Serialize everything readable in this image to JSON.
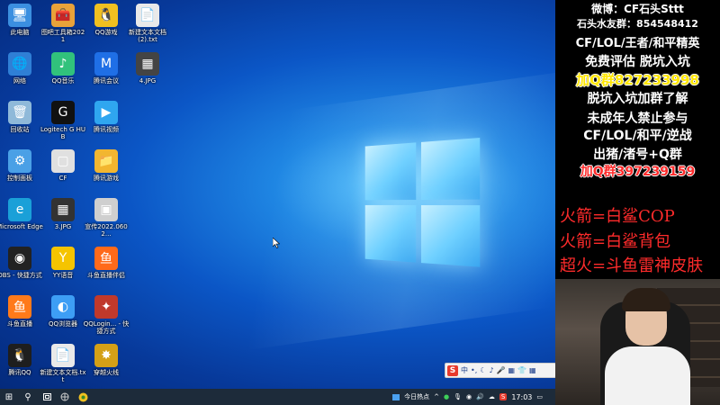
{
  "desktop_icons": [
    {
      "label": "此电脑",
      "icon": "computer-icon",
      "color": "#3b8fe0",
      "glyph": "🖥"
    },
    {
      "label": "图吧工具箱2021",
      "icon": "toolbox-icon",
      "color": "#e8a23a",
      "glyph": "🧰"
    },
    {
      "label": "QQ游戏",
      "icon": "qq-game-icon",
      "color": "#f0c020",
      "glyph": "🐧"
    },
    {
      "label": "新建文本文档 (2).txt",
      "icon": "text-file-icon",
      "color": "#e9e9e9",
      "glyph": "📄"
    },
    {
      "label": "网络",
      "icon": "network-icon",
      "color": "#2f7fd6",
      "glyph": "🌐"
    },
    {
      "label": "QQ音乐",
      "icon": "qq-music-icon",
      "color": "#31c27c",
      "glyph": "♪"
    },
    {
      "label": "腾讯会议",
      "icon": "tencent-meeting-icon",
      "color": "#1f6fe6",
      "glyph": "M"
    },
    {
      "label": "4.JPG",
      "icon": "image-file-icon",
      "color": "#444444",
      "glyph": "▦"
    },
    {
      "label": "回收站",
      "icon": "recycle-bin-icon",
      "color": "#8fb9d9",
      "glyph": "🗑"
    },
    {
      "label": "Logitech G HUB",
      "icon": "logitech-icon",
      "color": "#111111",
      "glyph": "G"
    },
    {
      "label": "腾讯视频",
      "icon": "tencent-video-icon",
      "color": "#2fa6f0",
      "glyph": "▶"
    },
    {
      "label": "控制面板",
      "icon": "control-panel-icon",
      "color": "#4aa0e6",
      "glyph": "⚙"
    },
    {
      "label": "CF",
      "icon": "cf-icon",
      "color": "#e0e0e0",
      "glyph": "▢"
    },
    {
      "label": "腾讯游戏",
      "icon": "tencent-game-icon",
      "color": "#f2b630",
      "glyph": "📁"
    },
    {
      "label": "Microsoft Edge",
      "icon": "edge-icon",
      "color": "#1aa0d8",
      "glyph": "e"
    },
    {
      "label": "3.JPG",
      "icon": "image-file-icon-2",
      "color": "#333333",
      "glyph": "▦"
    },
    {
      "label": "宣传2022.0602...",
      "icon": "promo-file-icon",
      "color": "#cfcfcf",
      "glyph": "▣"
    },
    {
      "label": "OBS - 快捷方式",
      "icon": "obs-icon",
      "color": "#222222",
      "glyph": "◉"
    },
    {
      "label": "YY语音",
      "icon": "yy-icon",
      "color": "#f5c400",
      "glyph": "Y"
    },
    {
      "label": "斗鱼直播伴侣",
      "icon": "douyu-companion-icon",
      "color": "#ff6a1a",
      "glyph": "鱼"
    },
    {
      "label": "斗鱼直播",
      "icon": "douyu-live-icon",
      "color": "#ff7a1a",
      "glyph": "鱼"
    },
    {
      "label": "QQ浏览器",
      "icon": "qq-browser-icon",
      "color": "#3d9ef5",
      "glyph": "◐"
    },
    {
      "label": "QQLogin... - 快捷方式",
      "icon": "qqlogin-icon",
      "color": "#c0392b",
      "glyph": "✦"
    },
    {
      "label": "腾讯QQ",
      "icon": "qq-icon",
      "color": "#1e1e1e",
      "glyph": "🐧"
    },
    {
      "label": "新建文本文档.txt",
      "icon": "text-file-icon-2",
      "color": "#e9e9e9",
      "glyph": "📄"
    },
    {
      "label": "穿越火线",
      "icon": "crossfire-icon",
      "color": "#d4a017",
      "glyph": "✸"
    }
  ],
  "ime": {
    "badge": "S",
    "items": [
      "中",
      "•,",
      "☾",
      "♪",
      "🎤",
      "▦",
      "👕",
      "▦"
    ]
  },
  "taskbar": {
    "start_glyph": "⊞",
    "search_glyph": "⚲",
    "news_label": "今日热点",
    "time": "17:03"
  },
  "panel": {
    "lines": [
      {
        "text": "微博：CF石头Sttt",
        "style": "outline-white",
        "size": 12
      },
      {
        "text": "石头水友群：854548412",
        "style": "outline-white",
        "size": 11
      },
      {
        "text": "CF/LOL/王者/和平精英",
        "style": "outline-white",
        "size": 13
      },
      {
        "text": "免费评估 脱坑入坑",
        "style": "outline-white",
        "size": 14
      },
      {
        "text": "加Q群827233998",
        "style": "yellow-glow",
        "size": 15
      },
      {
        "text": "脱坑入坑加群了解",
        "style": "outline-white",
        "size": 14
      },
      {
        "text": "未成年人禁止参与",
        "style": "outline-white",
        "size": 14
      },
      {
        "text": "CF/LOL/和平/逆战",
        "style": "outline-white",
        "size": 14
      },
      {
        "text": "出猪/渚号+Q群",
        "style": "outline-white",
        "size": 14
      },
      {
        "text": "加Q群397239159",
        "style": "red-bold",
        "size": 14
      },
      {
        "text": "火箭=白鲨COP",
        "style": "red-txt",
        "size": 18
      },
      {
        "text": "火箭=白鲨背包",
        "style": "red-txt",
        "size": 18
      },
      {
        "text": "超火=斗鱼雷神皮肤",
        "style": "red-txt",
        "size": 18
      }
    ]
  }
}
